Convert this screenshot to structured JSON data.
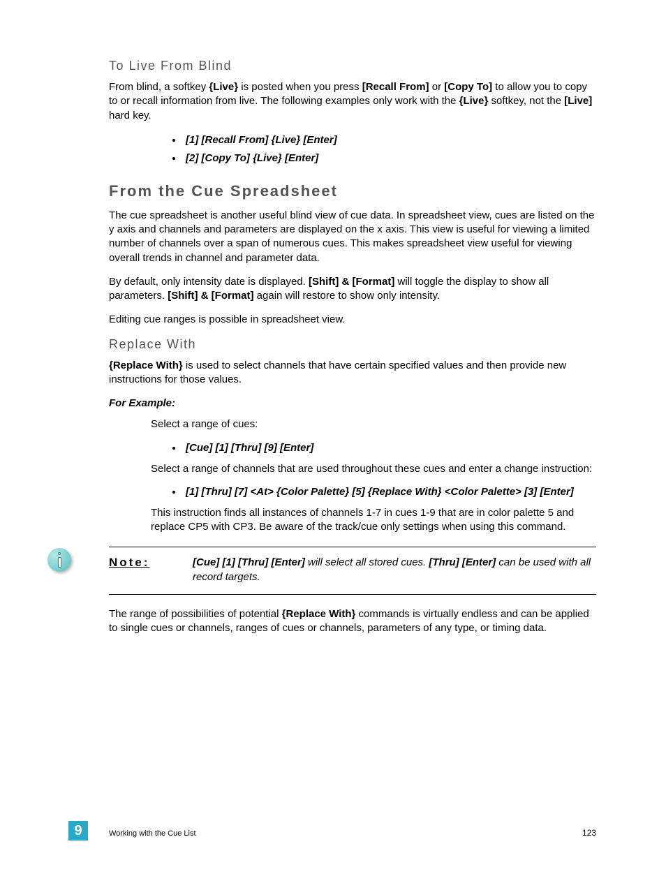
{
  "sec1_title": "To Live From Blind",
  "sec1_p1_a": "From blind, a softkey ",
  "sec1_p1_b": "{Live}",
  "sec1_p1_c": " is posted when you press ",
  "sec1_p1_d": "[Recall From]",
  "sec1_p1_e": " or ",
  "sec1_p1_f": "[Copy To]",
  "sec1_p1_g": " to allow you to copy to or recall information from live. The following examples only work with the ",
  "sec1_p1_h": "{Live}",
  "sec1_p1_i": " softkey, not the ",
  "sec1_p1_j": "[Live]",
  "sec1_p1_k": " hard key.",
  "sec1_bullets": [
    "[1] [Recall From] {Live} [Enter]",
    "[2] [Copy To] {Live} [Enter]"
  ],
  "sec2_title": "From the Cue Spreadsheet",
  "sec2_p1": "The cue spreadsheet is another useful blind view of cue data. In spreadsheet view, cues are listed on the y axis and channels and parameters are displayed on the x axis. This view is useful for viewing a limited number of channels over a span of numerous cues. This makes spreadsheet view useful for viewing overall trends in channel and parameter data.",
  "sec2_p2_a": "By default, only intensity date is displayed. ",
  "sec2_p2_b": "[Shift] & [Format]",
  "sec2_p2_c": " will toggle the display to show all parameters. ",
  "sec2_p2_d": "[Shift] & [Format]",
  "sec2_p2_e": " again will restore to show only intensity.",
  "sec2_p3": "Editing cue ranges is possible in spreadsheet view.",
  "sec3_title": "Replace With",
  "sec3_p1_a": "{Replace With}",
  "sec3_p1_b": " is used to select channels that have certain specified values and then provide new instructions for those values.",
  "example_label": "For Example:",
  "ex_p1": "Select a range of cues:",
  "ex_b1": "[Cue] [1] [Thru] [9] [Enter]",
  "ex_p2": "Select a range of channels that are used throughout these cues and enter a change instruction:",
  "ex_b2": "[1] [Thru] [7] <At> {Color Palette} [5] {Replace With} <Color Palette> [3] [Enter]",
  "ex_p3": "This instruction finds all instances of channels 1-7 in cues 1-9 that are in color palette 5 and replace CP5 with CP3. Be aware of the track/cue only settings when using this command.",
  "note_label": "Note:",
  "note_a": "[Cue] [1] [Thru] [Enter]",
  "note_b": " will select all stored cues. ",
  "note_c": "[Thru] [Enter]",
  "note_d": " can be used with all record targets.",
  "final_p_a": "The range of possibilities of potential ",
  "final_p_b": "{Replace With}",
  "final_p_c": " commands is virtually endless and can be applied to single cues or channels, ranges of cues or channels, parameters of any type, or timing data.",
  "chapter_number": "9",
  "footer_left": "Working with the Cue List",
  "page_number": "123"
}
